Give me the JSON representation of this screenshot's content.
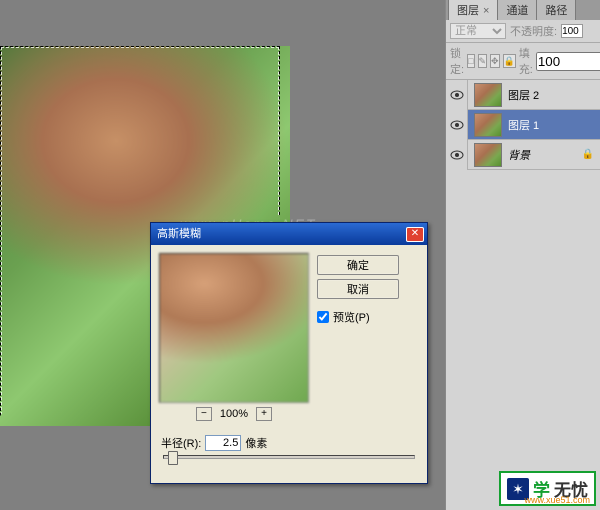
{
  "dialog": {
    "title": "高斯模糊",
    "ok": "确定",
    "cancel": "取消",
    "preview_label": "预览(P)",
    "preview_checked": true,
    "zoom_minus": "−",
    "zoom_percent": "100%",
    "zoom_plus": "+",
    "radius_label": "半径(R):",
    "radius_value": "2.5",
    "radius_unit": "像素"
  },
  "panels": {
    "tabs": [
      {
        "label": "图层",
        "active": true,
        "closable": true
      },
      {
        "label": "通道",
        "active": false
      },
      {
        "label": "路径",
        "active": false
      }
    ],
    "blend_mode": "正常",
    "opacity_label": "不透明度:",
    "opacity_value": "100",
    "lock_label": "锁定:",
    "lock_icons": [
      "□",
      "✎",
      "✥",
      "🔒"
    ],
    "fill_label": "填充:",
    "fill_value": "100",
    "layers": [
      {
        "name": "图层 2",
        "visible": true,
        "selected": false,
        "locked": false
      },
      {
        "name": "图层 1",
        "visible": true,
        "selected": true,
        "locked": false
      },
      {
        "name": "背景",
        "visible": true,
        "selected": false,
        "locked": true
      }
    ]
  },
  "watermark": "www.pHome.NET",
  "brand": {
    "primary": "学",
    "secondary": "无忧",
    "url": "www.xue51.com"
  }
}
